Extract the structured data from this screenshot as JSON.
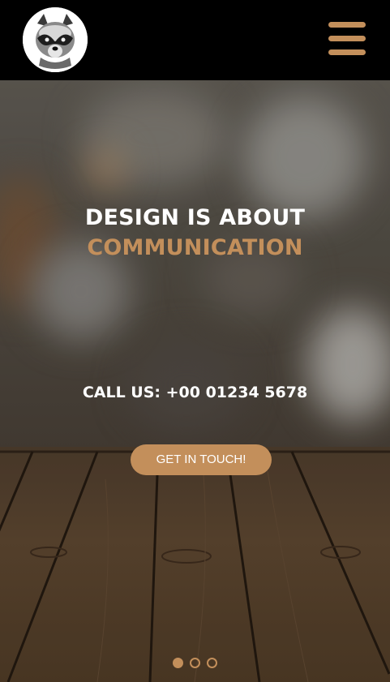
{
  "header": {
    "logo_icon": "raccoon-logo-icon",
    "menu_icon": "hamburger-menu-icon"
  },
  "hero": {
    "headline_line1": "DESIGN IS ABOUT",
    "headline_line2": "COMMUNICATION",
    "call_us": "CALL US: +00 01234 5678",
    "cta_label": "GET IN TOUCH!"
  },
  "slider": {
    "slide_count": 3,
    "active_index": 0
  },
  "colors": {
    "accent": "#c38f5b",
    "header_bg": "#000000",
    "text_light": "#ffffff"
  }
}
